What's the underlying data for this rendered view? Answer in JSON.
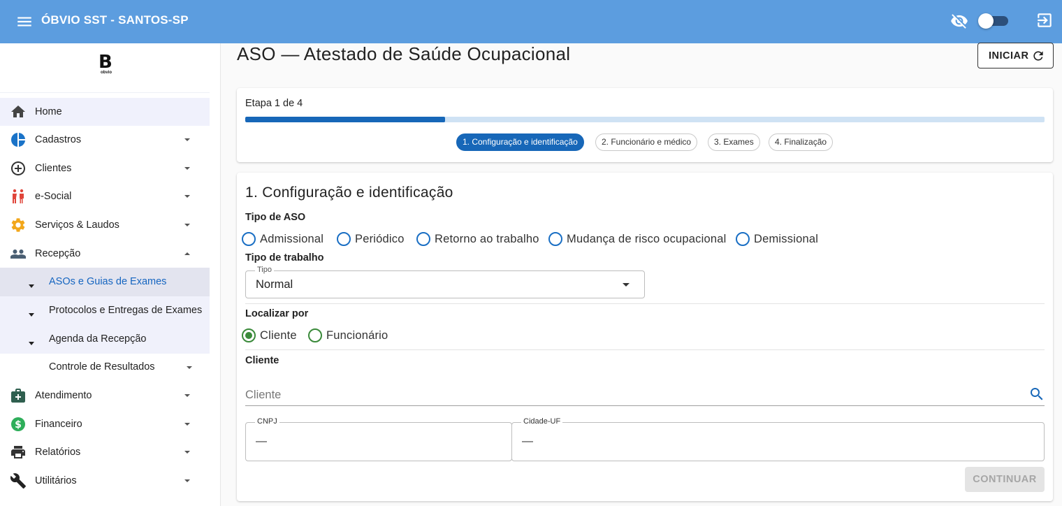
{
  "appbar": {
    "title": "ÓBVIO SST - SANTOS-SP",
    "menu_icon": "menu-icon",
    "visibility_icon": "eye-off-icon",
    "logout_icon": "logout-icon",
    "toggle_on": false
  },
  "sidebar": {
    "logo_mark": "B",
    "logo_text": "obvio",
    "items": [
      {
        "label": "Home",
        "icon": "home-icon"
      },
      {
        "label": "Cadastros",
        "icon": "pie-chart-icon"
      },
      {
        "label": "Clientes",
        "icon": "add-circle-icon"
      },
      {
        "label": "e-Social",
        "icon": "people-icon"
      },
      {
        "label": "Serviços & Laudos",
        "icon": "gear-icon"
      },
      {
        "label": "Recepção",
        "icon": "group-icon"
      },
      {
        "label": "Atendimento",
        "icon": "medical-bag-icon"
      },
      {
        "label": "Financeiro",
        "icon": "dollar-icon"
      },
      {
        "label": "Relatórios",
        "icon": "printer-icon"
      },
      {
        "label": "Utilitários",
        "icon": "wrench-icon"
      }
    ],
    "recepcao_sub": [
      {
        "label": "ASOs e Guias de Exames"
      },
      {
        "label": "Protocolos e Entregas de Exames"
      },
      {
        "label": "Agenda da Recepção"
      },
      {
        "label": "Controle de Resultados"
      }
    ]
  },
  "main": {
    "title": "ASO — Atestado de Saúde Ocupacional",
    "iniciar_label": "INICIAR",
    "etapa_label": "Etapa 1 de 4",
    "progress_fraction": 0.25,
    "steps": [
      "1. Configuração e identificação",
      "2. Funcionário e médico",
      "3. Exames",
      "4. Finalização"
    ],
    "section_title": "1. Configuração e identificação",
    "tipo_aso_label": "Tipo de ASO",
    "tipo_aso_options": [
      "Admissional",
      "Periódico",
      "Retorno ao trabalho",
      "Mudança de risco ocupacional",
      "Demissional"
    ],
    "tipo_trabalho_label": "Tipo de trabalho",
    "tipo_select_legend": "Tipo",
    "tipo_select_value": "Normal",
    "localizar_label": "Localizar por",
    "localizar_options": [
      "Cliente",
      "Funcionário"
    ],
    "localizar_selected": "Cliente",
    "cliente_label": "Cliente",
    "cliente_placeholder": "Cliente",
    "cnpj_legend": "CNPJ",
    "cnpj_value": "—",
    "cidade_legend": "Cidade-UF",
    "cidade_value": "—",
    "continuar_label": "CONTINUAR"
  },
  "colors": {
    "appbar": "#5c9ddf",
    "primary": "#1767b8",
    "radio_selected": "#3a8a3a"
  }
}
